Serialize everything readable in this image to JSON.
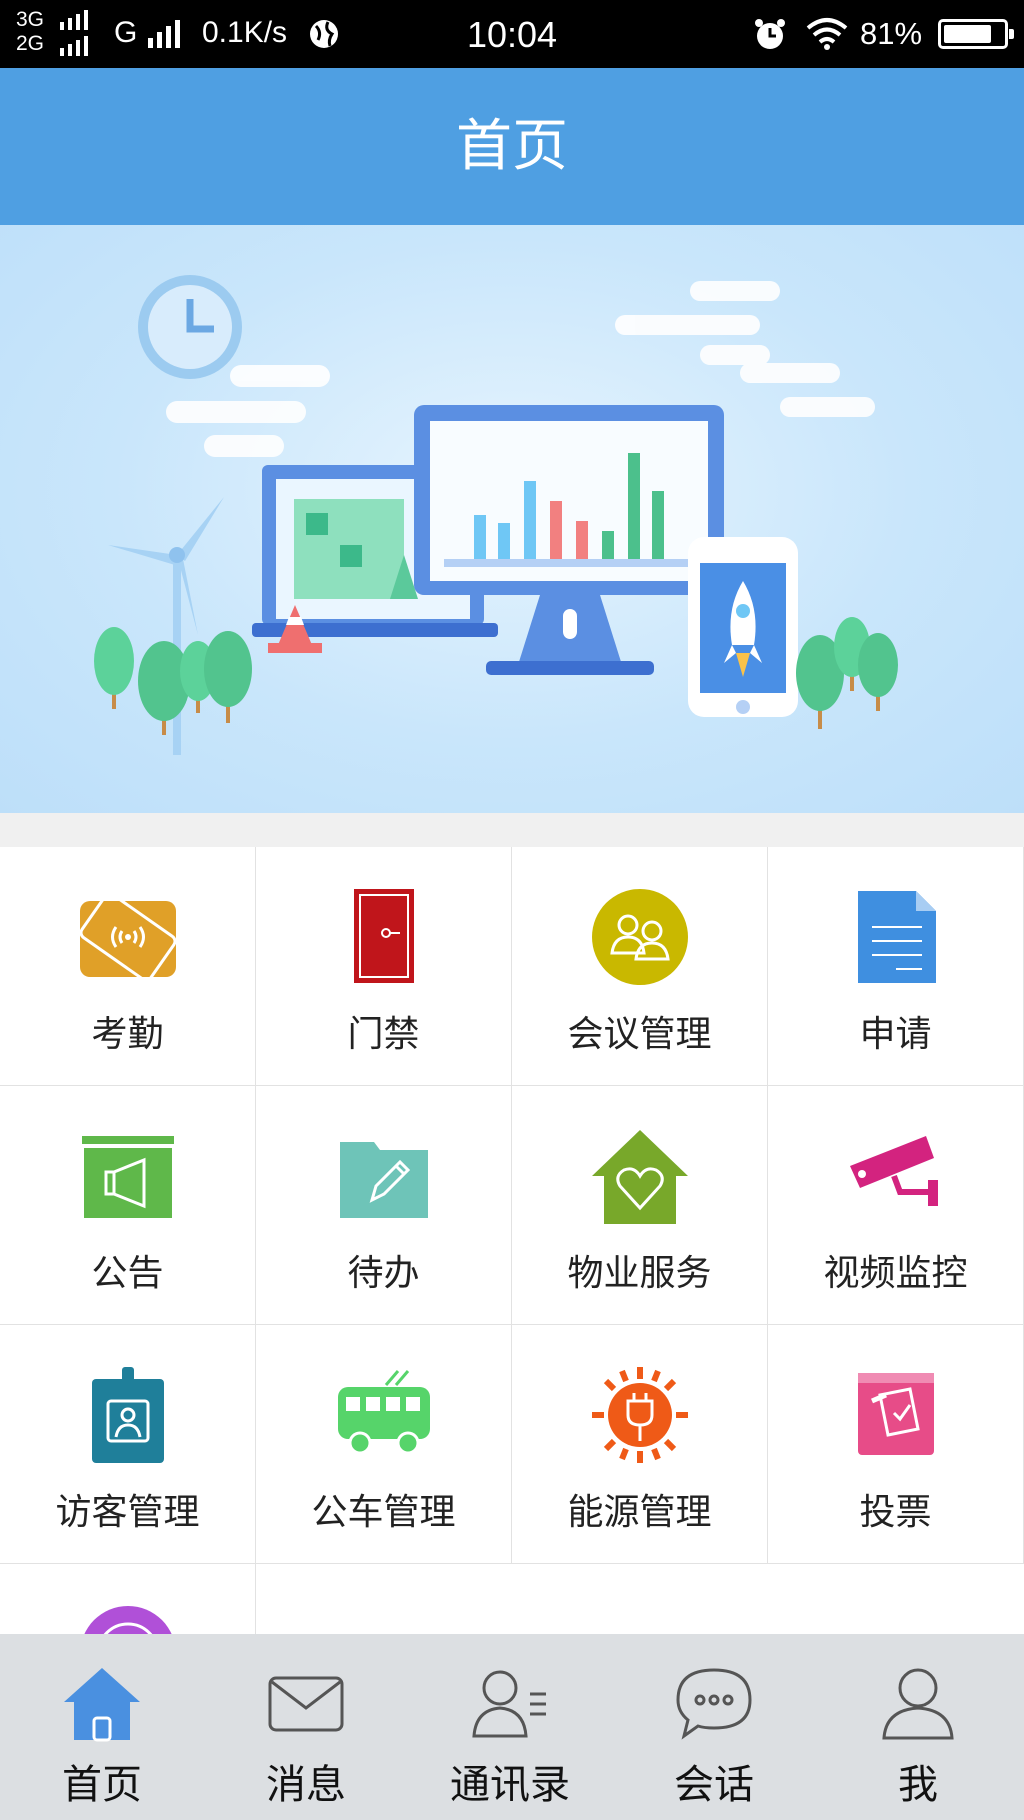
{
  "status_bar": {
    "net_top": "3G",
    "net_bottom": "2G",
    "carrier": "G",
    "speed": "0.1K/s",
    "time": "10:04",
    "battery": "81%",
    "battery_level": 0.81
  },
  "header": {
    "title": "首页"
  },
  "grid": {
    "items": [
      {
        "label": "考勤",
        "icon": "attendance-icon",
        "color": "#e0a028"
      },
      {
        "label": "门禁",
        "icon": "door-icon",
        "color": "#c0151b"
      },
      {
        "label": "会议管理",
        "icon": "meeting-icon",
        "color": "#c9b800"
      },
      {
        "label": "申请",
        "icon": "document-icon",
        "color": "#3f8fe0"
      },
      {
        "label": "公告",
        "icon": "megaphone-icon",
        "color": "#5fb84a"
      },
      {
        "label": "待办",
        "icon": "folder-pencil-icon",
        "color": "#6ec4b8"
      },
      {
        "label": "物业服务",
        "icon": "house-heart-icon",
        "color": "#78a82a"
      },
      {
        "label": "视频监控",
        "icon": "camera-icon",
        "color": "#d3237f"
      },
      {
        "label": "访客管理",
        "icon": "badge-icon",
        "color": "#1f7f9a"
      },
      {
        "label": "公车管理",
        "icon": "bus-icon",
        "color": "#56d46a"
      },
      {
        "label": "能源管理",
        "icon": "sun-plug-icon",
        "color": "#ef5a17"
      },
      {
        "label": "投票",
        "icon": "ballot-box-icon",
        "color": "#e74c88"
      },
      {
        "label": "",
        "icon": "partial-circle-icon",
        "color": "#b050d8"
      }
    ]
  },
  "tabbar": {
    "tabs": [
      {
        "label": "首页",
        "icon": "home-icon",
        "active": true
      },
      {
        "label": "消息",
        "icon": "mail-icon",
        "active": false
      },
      {
        "label": "通讯录",
        "icon": "contacts-icon",
        "active": false
      },
      {
        "label": "会话",
        "icon": "chat-icon",
        "active": false
      },
      {
        "label": "我",
        "icon": "user-icon",
        "active": false
      }
    ],
    "active_color": "#4a90e0",
    "inactive_color": "#555555"
  }
}
